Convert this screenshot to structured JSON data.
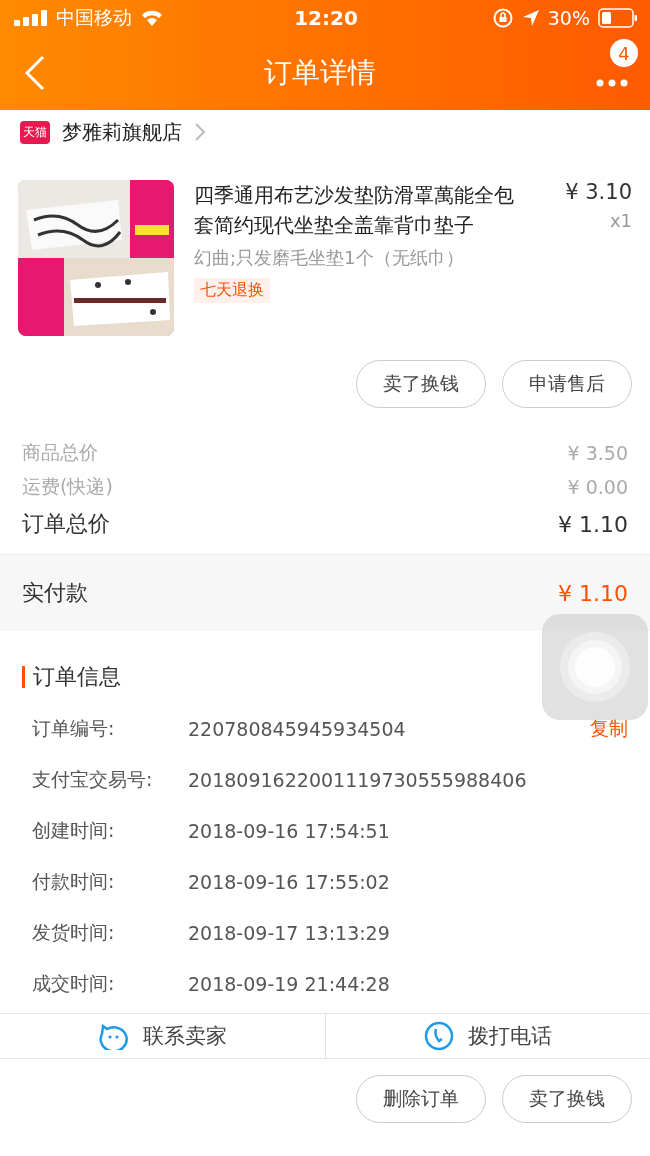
{
  "status_bar": {
    "carrier": "中国移动",
    "time": "12:20",
    "battery": "30%"
  },
  "nav": {
    "title": "订单详情",
    "badge": "4"
  },
  "shop": {
    "name": "梦雅莉旗舰店",
    "logo": "天猫"
  },
  "product": {
    "kind": "picture",
    "title": "四季通用布艺沙发垫防滑罩萬能全包套简约现代坐垫全盖靠背巾垫子",
    "spec": "幻曲;只发磨毛坐垫1个（无纸巾）",
    "tag": "七天退换",
    "price": "¥ 3.10",
    "qty": "x1"
  },
  "product_actions": [
    "卖了换钱",
    "申请售后"
  ],
  "summary": [
    {
      "label": "商品总价",
      "value": "¥ 3.50",
      "kind": "minor"
    },
    {
      "label": "运费(快递)",
      "value": "¥ 0.00",
      "kind": "minor"
    },
    {
      "label": "订单总价",
      "value": "¥ 1.10",
      "kind": "total"
    }
  ],
  "paid": {
    "label": "实付款",
    "value": "¥ 1.10"
  },
  "order_info": {
    "title": "订单信息",
    "rows": [
      {
        "label": "订单编号:",
        "value": "220780845945934504",
        "action": "复制"
      },
      {
        "label": "支付宝交易号:",
        "value": "2018091622001119730555988406"
      },
      {
        "label": "创建时间:",
        "value": "2018-09-16 17:54:51"
      },
      {
        "label": "付款时间:",
        "value": "2018-09-16 17:55:02"
      },
      {
        "label": "发货时间:",
        "value": "2018-09-17 13:13:29"
      },
      {
        "label": "成交时间:",
        "value": "2018-09-19 21:44:28"
      }
    ]
  },
  "contact": [
    {
      "label": "联系卖家",
      "kind": "chat"
    },
    {
      "label": "拨打电话",
      "kind": "phone"
    }
  ],
  "bottom_actions": [
    "删除订单",
    "卖了换钱"
  ]
}
